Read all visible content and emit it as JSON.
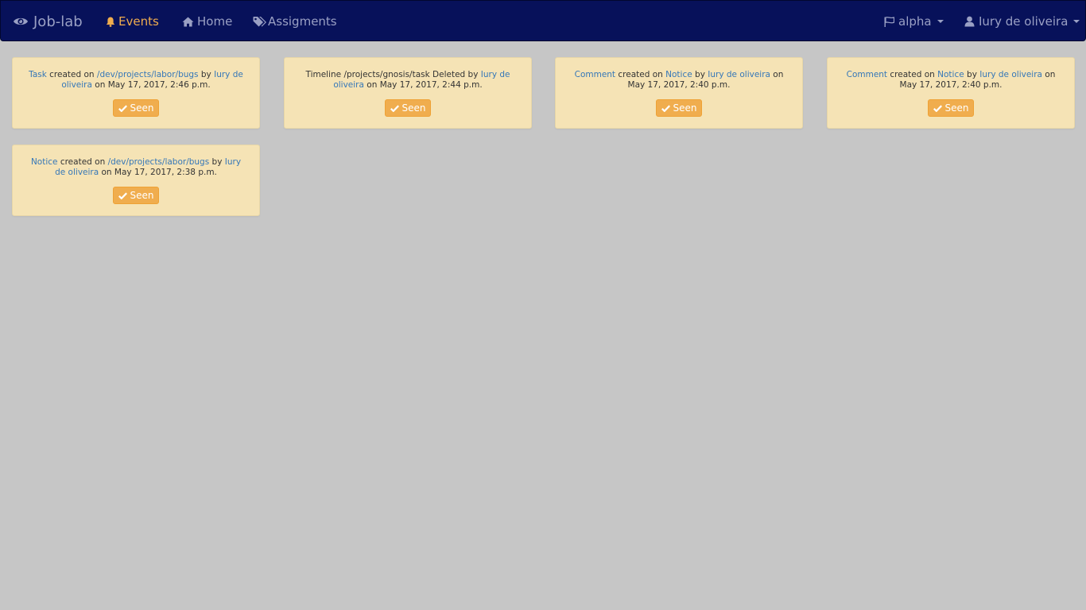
{
  "navbar": {
    "brand": "Job-lab",
    "brand_icon": "eye-icon",
    "links": [
      {
        "label": "Events",
        "icon": "bell-icon",
        "active": true
      },
      {
        "label": "Home",
        "icon": "home-icon",
        "active": false
      },
      {
        "label": "Assigments",
        "icon": "tags-icon",
        "active": false
      }
    ],
    "right": [
      {
        "label": "alpha",
        "icon": "flag-icon"
      },
      {
        "label": "Iury de oliveira",
        "icon": "user-icon"
      }
    ],
    "colors": {
      "background": "#07115a",
      "active": "#f0ad4e",
      "text": "#9aa0c4"
    }
  },
  "events": [
    {
      "parts": [
        {
          "text": "Task",
          "link": true
        },
        {
          "text": " created on ",
          "link": false
        },
        {
          "text": "/dev/projects/labor/bugs",
          "link": true
        },
        {
          "text": " by ",
          "link": false
        },
        {
          "text": "Iury de oliveira",
          "link": true
        },
        {
          "text": " on May 17, 2017, 2:46 p.m.",
          "link": false
        }
      ],
      "button": "Seen"
    },
    {
      "parts": [
        {
          "text": "Timeline /projects/gnosis/task Deleted by ",
          "link": false
        },
        {
          "text": "Iury de oliveira",
          "link": true
        },
        {
          "text": " on May 17, 2017, 2:44 p.m.",
          "link": false
        }
      ],
      "button": "Seen"
    },
    {
      "parts": [
        {
          "text": "Comment",
          "link": true
        },
        {
          "text": " created on ",
          "link": false
        },
        {
          "text": "Notice",
          "link": true
        },
        {
          "text": " by ",
          "link": false
        },
        {
          "text": "Iury de oliveira",
          "link": true
        },
        {
          "text": " on May 17, 2017, 2:40 p.m.",
          "link": false
        }
      ],
      "button": "Seen"
    },
    {
      "parts": [
        {
          "text": "Comment",
          "link": true
        },
        {
          "text": " created on ",
          "link": false
        },
        {
          "text": "Notice",
          "link": true
        },
        {
          "text": " by ",
          "link": false
        },
        {
          "text": "Iury de oliveira",
          "link": true
        },
        {
          "text": " on May 17, 2017, 2:40 p.m.",
          "link": false
        }
      ],
      "button": "Seen"
    },
    {
      "parts": [
        {
          "text": "Notice",
          "link": true
        },
        {
          "text": " created on ",
          "link": false
        },
        {
          "text": "/dev/projects/labor/bugs",
          "link": true
        },
        {
          "text": " by ",
          "link": false
        },
        {
          "text": "Iury de oliveira",
          "link": true
        },
        {
          "text": " on May 17, 2017, 2:38 p.m.",
          "link": false
        }
      ],
      "button": "Seen",
      "button_icon": "check-icon"
    }
  ]
}
